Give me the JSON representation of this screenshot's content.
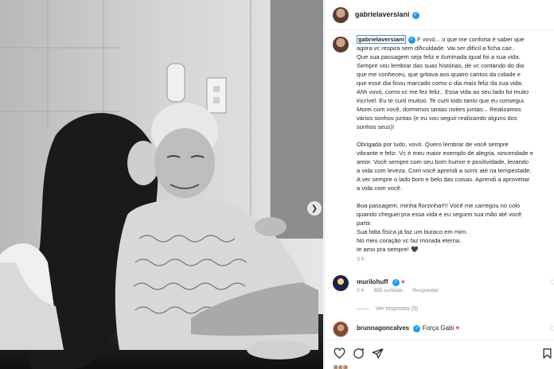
{
  "post": {
    "username": "gabrielaversiani",
    "caption_lines": [
      "F vovó... o que me conforta é saber que",
      "agora vc respira sem dificuldade. Vai ser difícil a ficha cair..",
      "Que sua passagem seja feliz e iluminada igual foi a sua vida.",
      "Sempre vou lembrar das suas histórias, de vc contando do dia",
      "que me conheceu, que gritava aos quatro cantos da cidade e",
      "que esse dia ficou marcado como o dia mais feliz da sua vida.",
      "Ahh vovó, como vc me fez feliz.. Essa vida ao seu lado foi muito",
      "incrível. Eu te curti muitoo. Te curti todo tanto que eu consegui.",
      "Morei com você, dormimos tantas noites juntas... Realizamos",
      "vários sonhos juntas (e eu vou seguir realizando alguns dos",
      "sonhos seus)!",
      "",
      "Obrigada por tudo, vovó. Quero lembrar de você sempre",
      "vibrante e feliz. Vc é meu maior exemplo de alegria, sinceridade e",
      "amor. Você sempre com seu bom humor e positividade, levando",
      "a vida com leveza. Com você aprendi a sorrir até na tempestade.",
      "A ver sempre o lado bom e belo das coisas. Aprendi a aproveitar",
      "a vida com você.",
      "",
      "Boa passagem, minha florzinha!!!! Você me carregou no colo",
      "quando cheguei pra essa vida e eu segurei sua mão até você",
      "partir.",
      "Sua falta física já faz um buraco em mim.",
      "No meu coração vc faz morada eterna.",
      "te amo pra sempre! 🖤"
    ],
    "time": "3 h"
  },
  "comments": [
    {
      "username": "murilohuff",
      "text": "",
      "heart": "♥",
      "time": "3 h",
      "likes": "685 curtidas",
      "reply": "Responder"
    },
    {
      "username": "brunnagoncalves",
      "text": "Força Gabi",
      "heart": "♥"
    }
  ],
  "view_replies": "Ver respostas (5)",
  "icons": {
    "next": "chevron-right-icon",
    "like": "heart-icon",
    "comment": "comment-icon",
    "share": "share-icon",
    "save": "bookmark-icon"
  },
  "colors": {
    "verified": "#1d9bf0",
    "heart": "#ed4956",
    "muted": "#8e8e8e"
  }
}
